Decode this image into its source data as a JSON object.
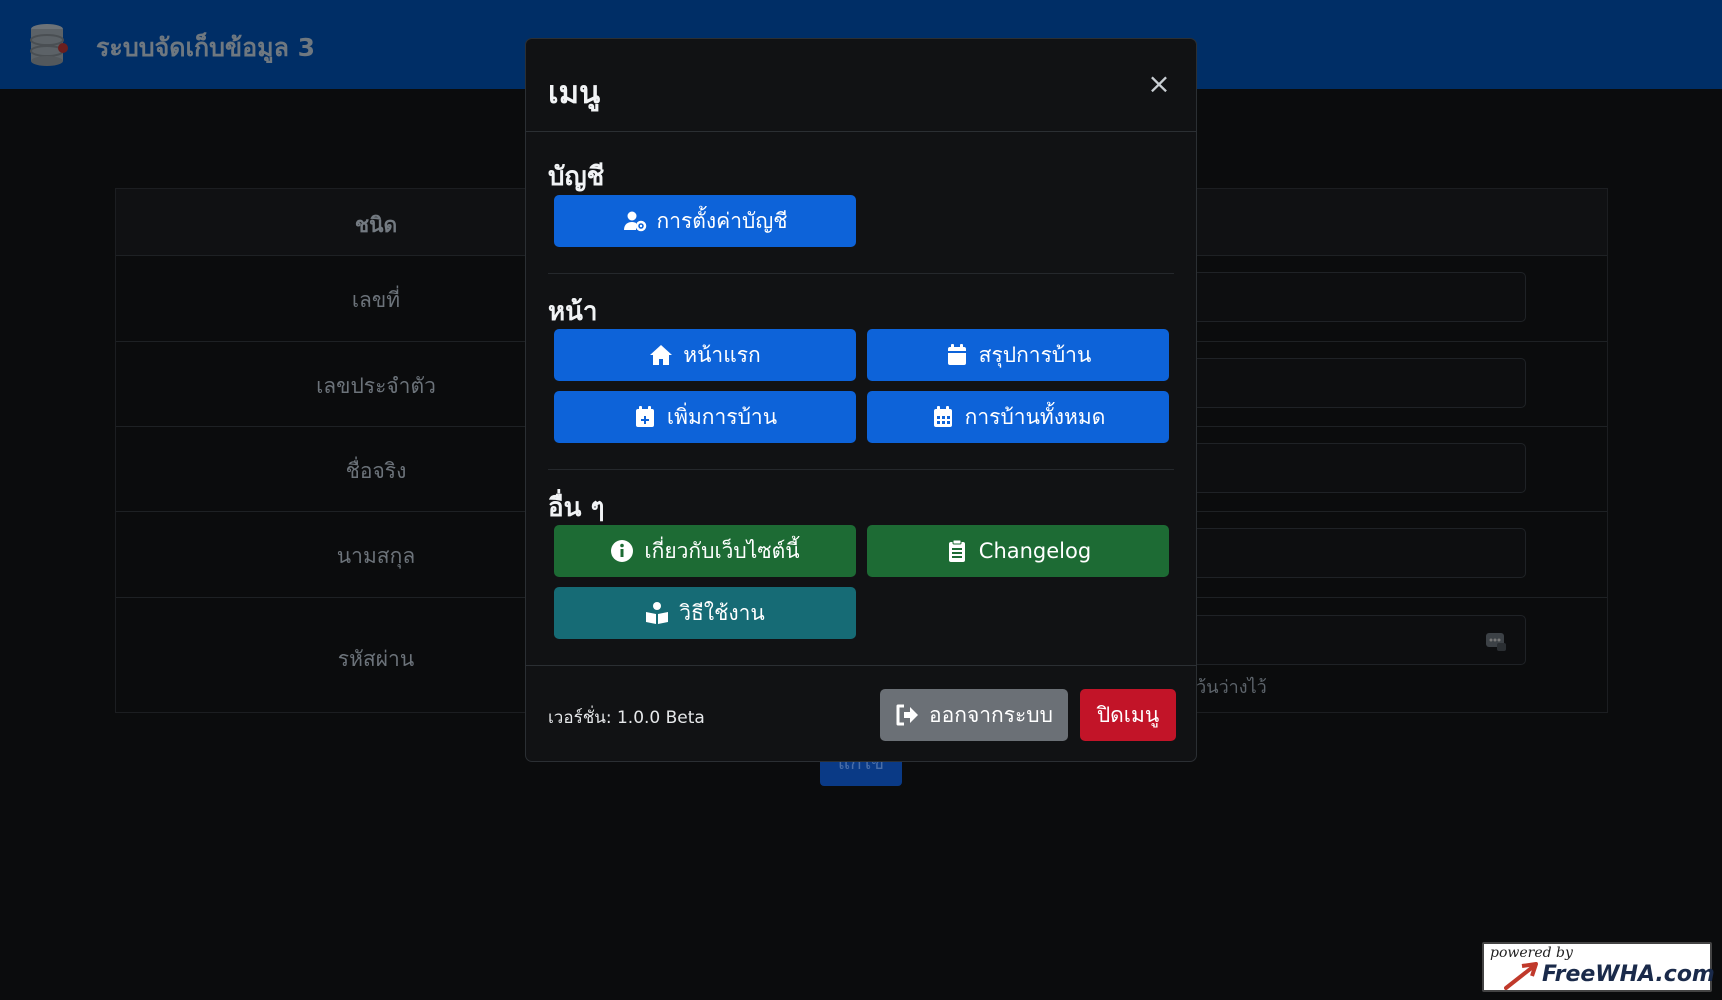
{
  "app": {
    "title": "ระบบจัดเก็บข้อมูล 3"
  },
  "background_form": {
    "header_label": "ชนิด",
    "rows": [
      {
        "label": "เลขที่"
      },
      {
        "label": "เลขประจำตัว"
      },
      {
        "label": "ชื่อจริง"
      },
      {
        "label": "นามสกุล"
      },
      {
        "label": "รหัสผ่าน"
      }
    ],
    "password_hint": "เว้นว่างไว้",
    "submit_label": "แก้ไข"
  },
  "modal": {
    "title": "เมนู",
    "close_symbol": "×",
    "sections": {
      "account": {
        "title": "บัญชี",
        "account_settings_label": "การตั้งค่าบัญชี"
      },
      "pages": {
        "title": "หน้า",
        "home_label": "หน้าแรก",
        "homework_summary_label": "สรุปการบ้าน",
        "add_homework_label": "เพิ่มการบ้าน",
        "all_homework_label": "การบ้านทั้งหมด"
      },
      "other": {
        "title": "อื่น ๆ",
        "about_label": "เกี่ยวกับเว็บไซต์นี้",
        "changelog_label": "Changelog",
        "how_to_use_label": "วิธีใช้งาน"
      }
    },
    "footer": {
      "version_text": "เวอร์ชั่น: 1.0.0 Beta",
      "logout_label": "ออกจากระบบ",
      "close_menu_label": "ปิดเมนู"
    }
  },
  "badge": {
    "powered_by": "powered by",
    "brand": "FreeWHA.com"
  },
  "colors": {
    "navbar": "#002e66",
    "primary": "#0d63d9",
    "success": "#1d6b34",
    "info": "#166b75",
    "secondary": "#6b7076",
    "danger": "#c21428"
  }
}
